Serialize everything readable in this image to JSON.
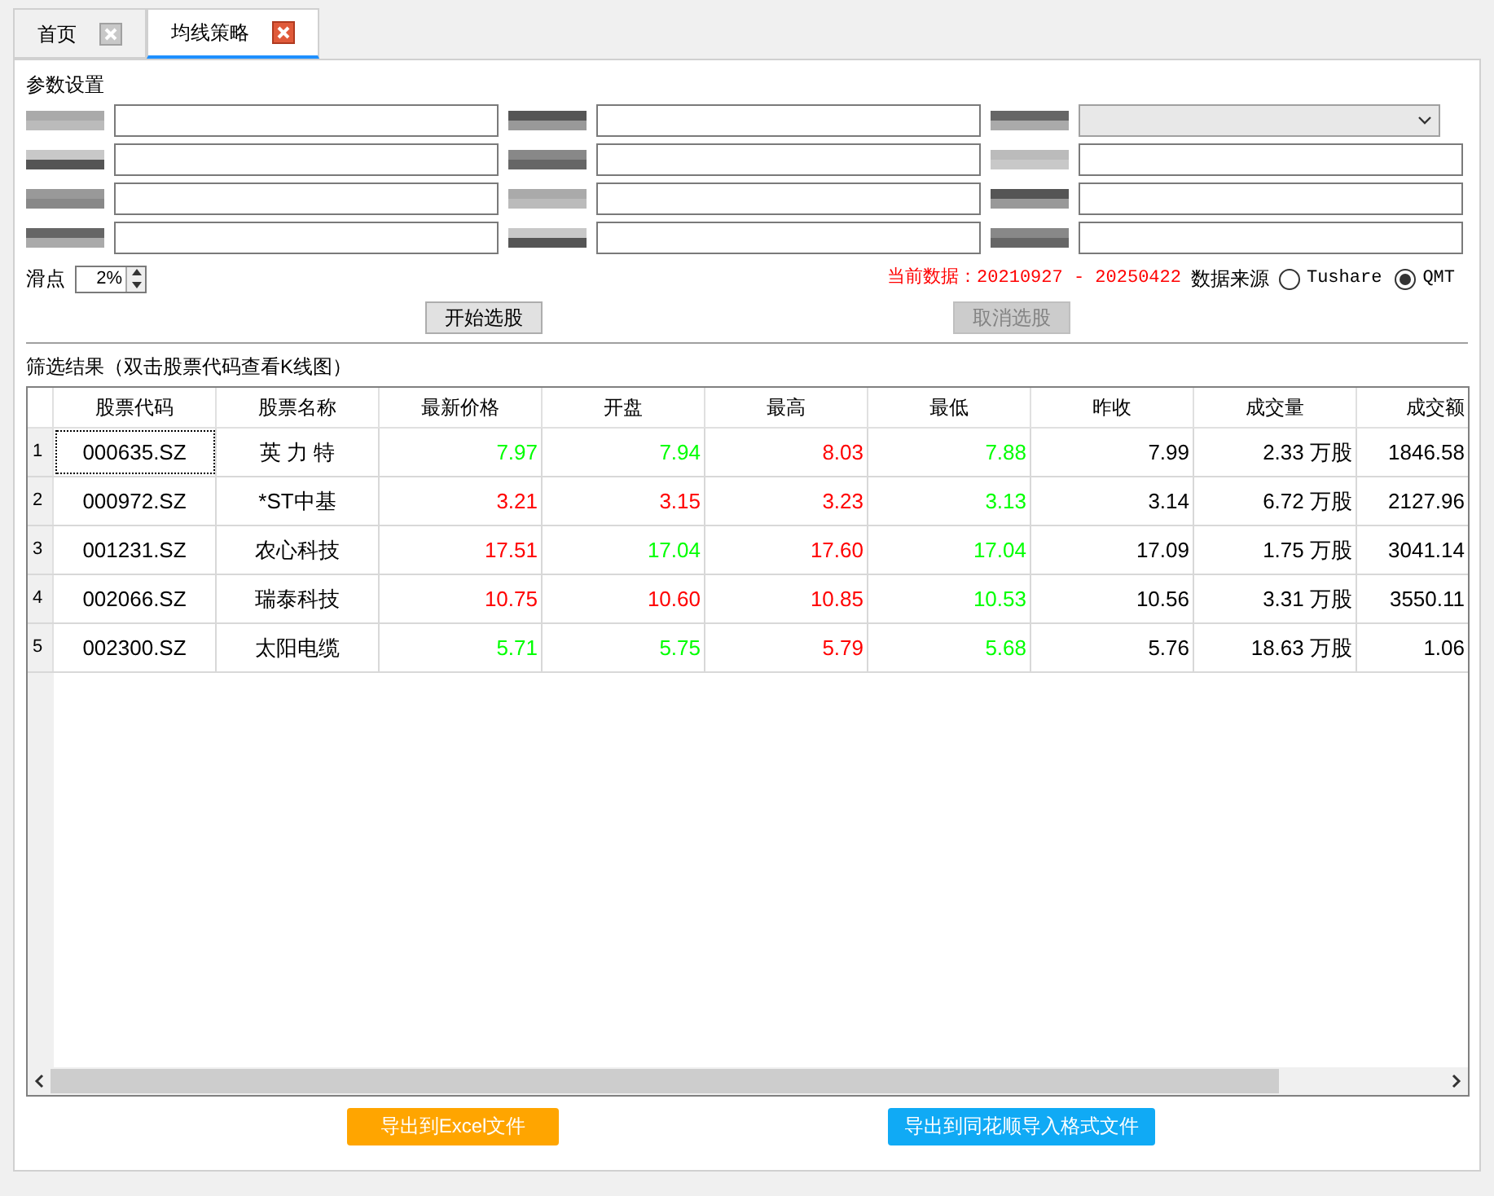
{
  "tabs": [
    {
      "label": "首页",
      "selected": false
    },
    {
      "label": "均线策略",
      "selected": true
    }
  ],
  "params": {
    "title": "参数设置",
    "slippage_label": "滑点",
    "slippage_value": "2%",
    "data_range": "当前数据：20210927 - 20250422",
    "source_label": "数据来源",
    "sources": [
      {
        "label": "Tushare",
        "selected": false
      },
      {
        "label": "QMT",
        "selected": true
      }
    ],
    "buttons": [
      {
        "label": "开始选股",
        "disabled": false
      },
      {
        "label": "取消选股",
        "disabled": true
      }
    ]
  },
  "results": {
    "title": "筛选结果（双击股票代码查看K线图）",
    "columns": [
      "股票代码",
      "股票名称",
      "最新价格",
      "开盘",
      "最高",
      "最低",
      "昨收",
      "成交量",
      "成交额"
    ],
    "rows": [
      {
        "index": "1",
        "focused": true,
        "code": "000635.SZ",
        "name": "英 力 特",
        "values": [
          {
            "text": "7.97",
            "color": "#00ff00"
          },
          {
            "text": "7.94",
            "color": "#00ff00"
          },
          {
            "text": "8.03",
            "color": "#ff0000"
          },
          {
            "text": "7.88",
            "color": "#00ff00"
          },
          {
            "text": "7.99",
            "color": "#000000"
          },
          {
            "text": "2.33 万股",
            "color": "#000000"
          },
          {
            "text": "1846.58",
            "color": "#000000"
          }
        ]
      },
      {
        "index": "2",
        "focused": false,
        "code": "000972.SZ",
        "name": "*ST中基",
        "values": [
          {
            "text": "3.21",
            "color": "#ff0000"
          },
          {
            "text": "3.15",
            "color": "#ff0000"
          },
          {
            "text": "3.23",
            "color": "#ff0000"
          },
          {
            "text": "3.13",
            "color": "#00ff00"
          },
          {
            "text": "3.14",
            "color": "#000000"
          },
          {
            "text": "6.72 万股",
            "color": "#000000"
          },
          {
            "text": "2127.96",
            "color": "#000000"
          }
        ]
      },
      {
        "index": "3",
        "focused": false,
        "code": "001231.SZ",
        "name": "农心科技",
        "values": [
          {
            "text": "17.51",
            "color": "#ff0000"
          },
          {
            "text": "17.04",
            "color": "#00ff00"
          },
          {
            "text": "17.60",
            "color": "#ff0000"
          },
          {
            "text": "17.04",
            "color": "#00ff00"
          },
          {
            "text": "17.09",
            "color": "#000000"
          },
          {
            "text": "1.75 万股",
            "color": "#000000"
          },
          {
            "text": "3041.14",
            "color": "#000000"
          }
        ]
      },
      {
        "index": "4",
        "focused": false,
        "code": "002066.SZ",
        "name": "瑞泰科技",
        "values": [
          {
            "text": "10.75",
            "color": "#ff0000"
          },
          {
            "text": "10.60",
            "color": "#ff0000"
          },
          {
            "text": "10.85",
            "color": "#ff0000"
          },
          {
            "text": "10.53",
            "color": "#00ff00"
          },
          {
            "text": "10.56",
            "color": "#000000"
          },
          {
            "text": "3.31 万股",
            "color": "#000000"
          },
          {
            "text": "3550.11",
            "color": "#000000"
          }
        ]
      },
      {
        "index": "5",
        "focused": false,
        "code": "002300.SZ",
        "name": "太阳电缆",
        "values": [
          {
            "text": "5.71",
            "color": "#00ff00"
          },
          {
            "text": "5.75",
            "color": "#00ff00"
          },
          {
            "text": "5.79",
            "color": "#ff0000"
          },
          {
            "text": "5.68",
            "color": "#00ff00"
          },
          {
            "text": "5.76",
            "color": "#000000"
          },
          {
            "text": "18.63 万股",
            "color": "#000000"
          },
          {
            "text": "1.06",
            "color": "#000000"
          }
        ]
      }
    ]
  },
  "export_buttons": [
    {
      "label": "导出到Excel文件",
      "kind": "orange"
    },
    {
      "label": "导出到同花顺导入格式文件",
      "kind": "blue"
    }
  ]
}
